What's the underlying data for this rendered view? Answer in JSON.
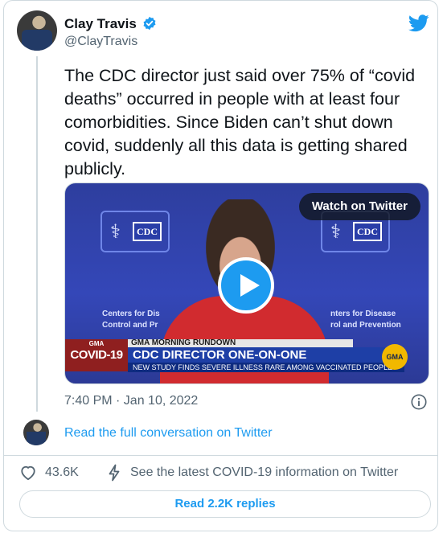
{
  "author": {
    "name": "Clay Travis",
    "handle": "@ClayTravis"
  },
  "tweet": {
    "text": "The CDC director just said over 75% of “covid deaths” occurred in people with at least four comorbidities. Since Biden can’t shut down covid, suddenly all this data is getting shared publicly.",
    "timestamp": "7:40 PM · Jan 10, 2022"
  },
  "media": {
    "watch_label": "Watch on Twitter",
    "cdc_logo_text": "CDC",
    "agency_left": "Centers for Dis\nControl and Pr",
    "agency_right": "nters for Disease\nrol and Prevention",
    "chyron": {
      "badge_small": "GMA",
      "badge_big": "COVID-19",
      "show": "GMA MORNING RUNDOWN",
      "headline": "CDC DIRECTOR ONE-ON-ONE",
      "subline": "NEW STUDY FINDS SEVERE ILLNESS RARE AMONG VACCINATED PEOPLE",
      "network_logo": "GMA"
    }
  },
  "conversation_link": "Read the full conversation on Twitter",
  "actions": {
    "likes": "43.6K",
    "covid_info": "See the latest COVID-19 information on Twitter",
    "replies_button": "Read 2.2K replies"
  },
  "colors": {
    "accent": "#1d9bf0",
    "text": "#0f1419",
    "muted": "#536471",
    "border": "#cfd9de"
  },
  "icons": [
    "verified-badge-icon",
    "twitter-bird-icon",
    "play-icon",
    "info-icon",
    "heart-icon",
    "bolt-icon"
  ]
}
